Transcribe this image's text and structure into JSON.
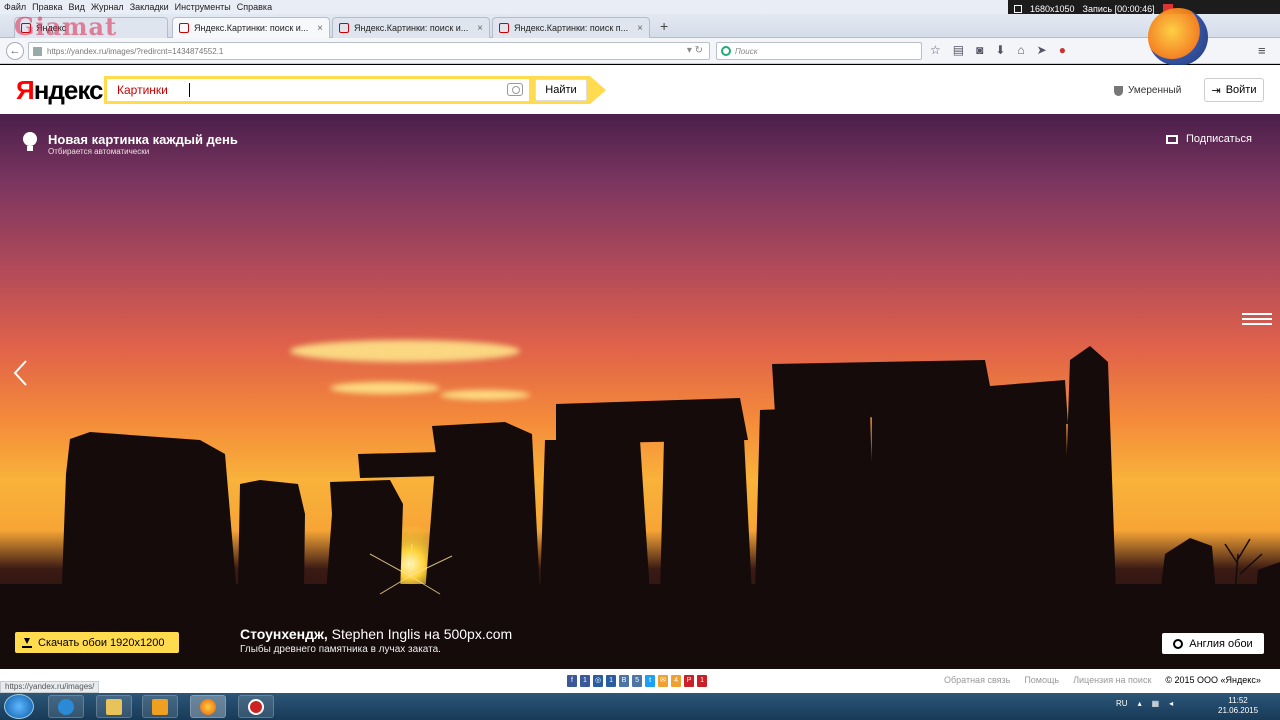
{
  "firefox": {
    "menu": [
      "Файл",
      "Правка",
      "Вид",
      "Журнал",
      "Закладки",
      "Инструменты",
      "Справка"
    ],
    "tabs": [
      {
        "label": "Яндекс"
      },
      {
        "label": "Яндекс.Картинки: поиск и..."
      },
      {
        "label": "Яндекс.Картинки: поиск и..."
      },
      {
        "label": "Яндекс.Картинки: поиск п..."
      }
    ],
    "new_tab": "+",
    "url": "https://yandex.ru/images/?redircnt=1434874552.1",
    "search_placeholder": "Поиск",
    "recorder": {
      "resolution": "1680x1050",
      "status": "Запись [00:00:46]"
    }
  },
  "watermark": "Giamat",
  "yandex": {
    "logo": "Яндекс",
    "logo_first_letter": "Я",
    "logo_rest": "ндекс",
    "search_scope": "Картинки",
    "search_button": "Найти",
    "filter": "Умеренный",
    "login": "Войти"
  },
  "hero": {
    "title": "Новая картинка каждый день",
    "subtitle": "Отбирается автоматически",
    "subscribe": "Подписаться",
    "download": "Скачать обои 1920x1200",
    "caption_title": "Стоунхендж,",
    "caption_author": "Stephen Inglis на 500px.com",
    "caption_desc": "Глыбы древнего памятника в лучах заката.",
    "country_button": "Англия обои"
  },
  "footer": {
    "status_url": "https://yandex.ru/images/",
    "shares": [
      {
        "label": "f",
        "count": "1",
        "color": "#3b5998"
      },
      {
        "label": "◎",
        "count": "1",
        "color": "#2a5d9f"
      },
      {
        "label": "В",
        "count": "5",
        "color": "#4c75a3"
      },
      {
        "label": "t",
        "count": "",
        "color": "#1da1f2"
      },
      {
        "label": "✉",
        "count": "4",
        "color": "#f0a030"
      },
      {
        "label": "P",
        "count": "1",
        "color": "#cb2027"
      }
    ],
    "links": [
      "Обратная связь",
      "Помощь",
      "Лицензия на поиск"
    ],
    "copyright": "© 2015  ООО «Яндекс»"
  },
  "taskbar": {
    "lang": "RU",
    "time": "11:52",
    "date": "21.06.2015"
  }
}
